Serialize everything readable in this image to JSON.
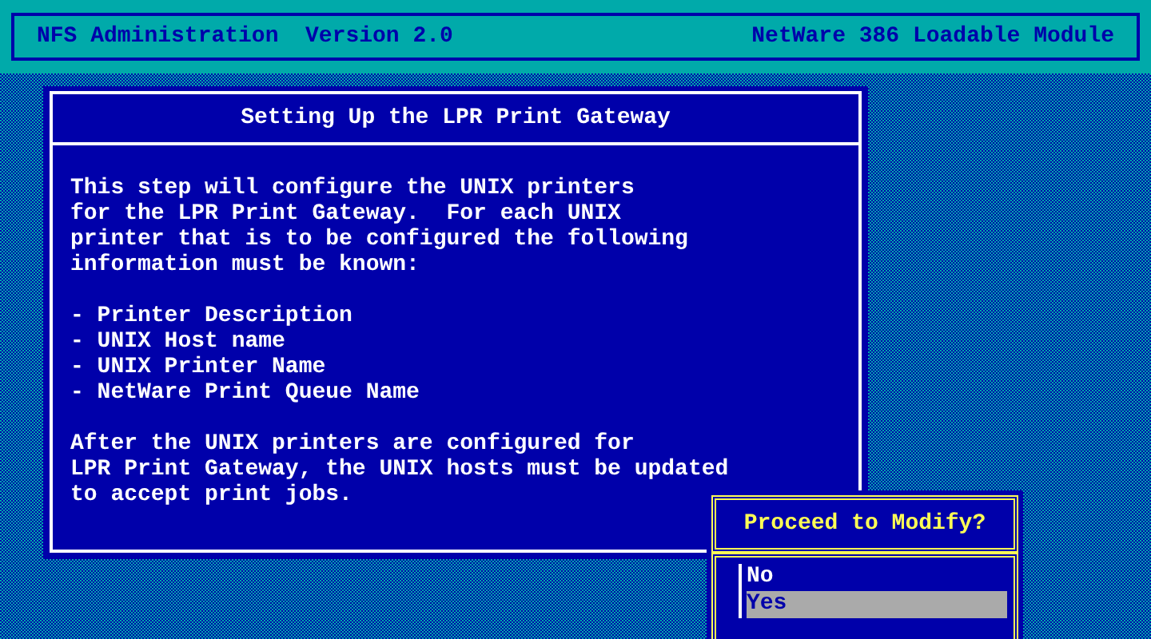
{
  "header": {
    "title": "NFS Administration  Version 2.0",
    "module": "NetWare 386 Loadable Module"
  },
  "panel": {
    "title": "Setting Up the LPR Print Gateway",
    "intro": [
      "This step will configure the UNIX printers",
      "for the LPR Print Gateway.  For each UNIX",
      "printer that is to be configured the following",
      "information must be known:"
    ],
    "items": [
      "- Printer Description",
      "- UNIX Host name",
      "- UNIX Printer Name",
      "- NetWare Print Queue Name"
    ],
    "outro": [
      "After the UNIX printers are configured for",
      "LPR Print Gateway, the UNIX hosts must be updated",
      "to accept print jobs."
    ]
  },
  "dialog": {
    "title": "Proceed to Modify?",
    "options": [
      {
        "label": "No",
        "selected": false
      },
      {
        "label": "Yes",
        "selected": true
      }
    ]
  }
}
